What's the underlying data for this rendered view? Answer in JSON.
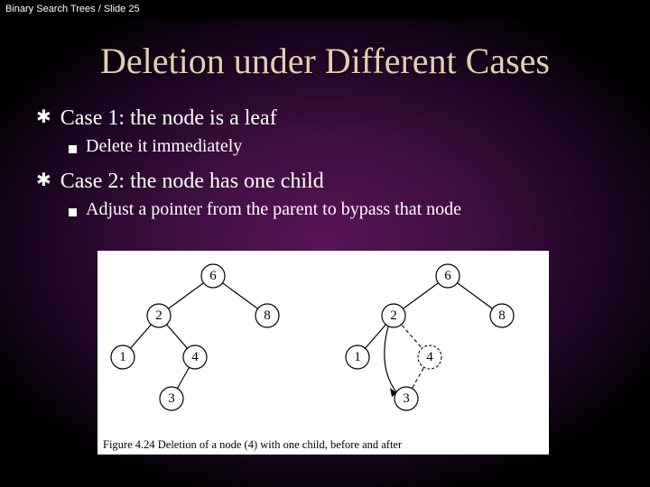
{
  "topbar": "Binary Search Trees / Slide 25",
  "title": "Deletion under Different Cases",
  "bullets": {
    "case1": "Case 1: the node is a leaf",
    "case1_sub": "Delete it immediately",
    "case2": "Case 2: the node has one child",
    "case2_sub": "Adjust a pointer from the parent to bypass that node"
  },
  "figure": {
    "caption": "Figure 4.24   Deletion of a node (4) with one child, before and after",
    "node_labels": {
      "root": "6",
      "n2": "2",
      "n8": "8",
      "n1": "1",
      "n4": "4",
      "n3": "3"
    }
  },
  "chart_data": {
    "type": "diagram",
    "description": "Binary search tree before and after deleting node 4 (which has one child, 3).",
    "trees": [
      {
        "label": "before",
        "edges": [
          [
            "6",
            "2"
          ],
          [
            "6",
            "8"
          ],
          [
            "2",
            "1"
          ],
          [
            "2",
            "4"
          ],
          [
            "4",
            "3"
          ]
        ],
        "deletedPath": null
      },
      {
        "label": "after",
        "edges": [
          [
            "6",
            "2"
          ],
          [
            "6",
            "8"
          ],
          [
            "2",
            "1"
          ],
          [
            "2",
            "3"
          ]
        ],
        "dashedEdges": [
          [
            "2",
            "4"
          ],
          [
            "4",
            "3"
          ]
        ],
        "bypass": [
          "2",
          "3"
        ]
      }
    ]
  }
}
